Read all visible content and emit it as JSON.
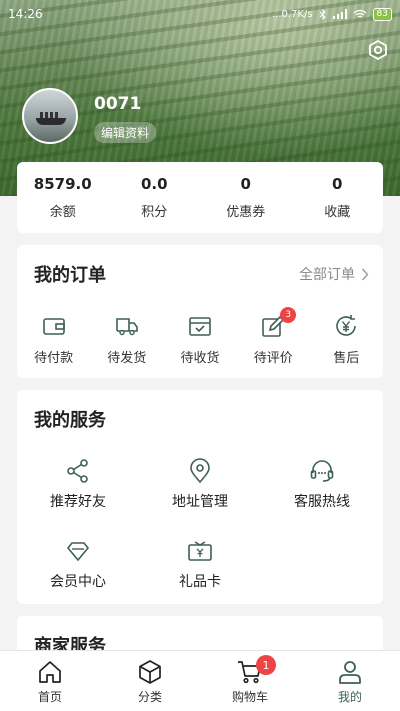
{
  "status_bar": {
    "time": "14:26",
    "network_speed": "...0.7K/s",
    "battery": "83"
  },
  "profile": {
    "username": "0071",
    "edit_label": "编辑资料"
  },
  "stats": [
    {
      "value": "8579.0",
      "label": "余额"
    },
    {
      "value": "0.0",
      "label": "积分"
    },
    {
      "value": "0",
      "label": "优惠券"
    },
    {
      "value": "0",
      "label": "收藏"
    }
  ],
  "orders": {
    "title": "我的订单",
    "all_label": "全部订单",
    "items": [
      {
        "label": "待付款",
        "icon": "wallet-icon"
      },
      {
        "label": "待发货",
        "icon": "truck-icon"
      },
      {
        "label": "待收货",
        "icon": "package-icon"
      },
      {
        "label": "待评价",
        "icon": "edit-review-icon",
        "badge": "3"
      },
      {
        "label": "售后",
        "icon": "refund-icon"
      }
    ]
  },
  "services": {
    "title": "我的服务",
    "items": [
      {
        "label": "推荐好友",
        "icon": "share-icon"
      },
      {
        "label": "地址管理",
        "icon": "location-icon"
      },
      {
        "label": "客服热线",
        "icon": "headset-icon"
      },
      {
        "label": "会员中心",
        "icon": "diamond-icon"
      },
      {
        "label": "礼品卡",
        "icon": "gift-card-icon"
      }
    ]
  },
  "merchant": {
    "title": "商家服务"
  },
  "tabbar": {
    "items": [
      {
        "label": "首页",
        "icon": "home-icon"
      },
      {
        "label": "分类",
        "icon": "category-cube-icon"
      },
      {
        "label": "购物车",
        "icon": "cart-icon",
        "badge": "1"
      },
      {
        "label": "我的",
        "icon": "user-icon",
        "active": true
      }
    ]
  },
  "colors": {
    "accent": "#3e5f57",
    "badge": "#ef4444",
    "background": "#f3f3f3"
  }
}
